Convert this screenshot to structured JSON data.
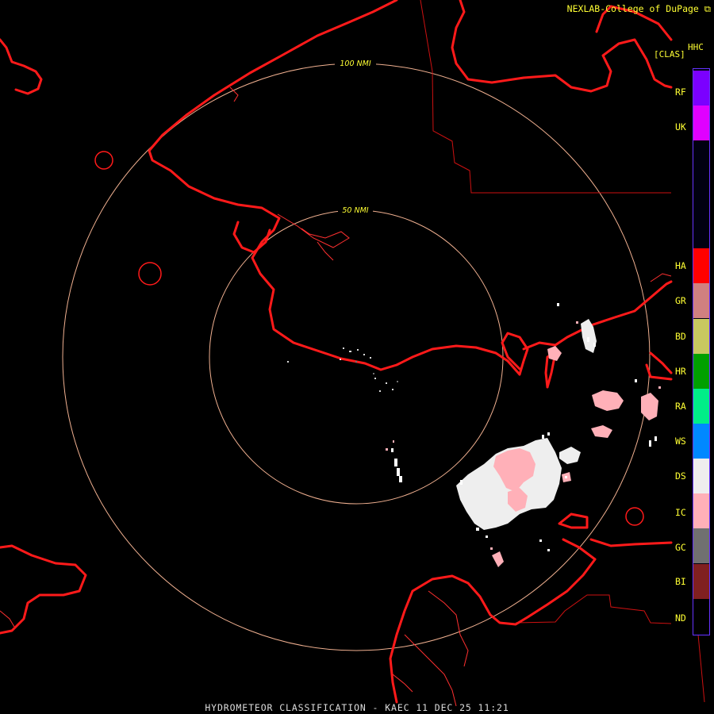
{
  "header": {
    "credit": "NEXLAB-College of DuPage",
    "credit_icon": "external-link-icon",
    "product_code": "HHC",
    "product_class": "[CLAS]"
  },
  "range_rings": [
    {
      "label": "100 NMI"
    },
    {
      "label": "50 NMI"
    }
  ],
  "legend": {
    "items": [
      {
        "code": "RF",
        "color": "#7b00ff"
      },
      {
        "code": "UK",
        "color": "#e000ff"
      },
      {
        "code": "HA",
        "color": "#ff0000"
      },
      {
        "code": "GR",
        "color": "#d08080"
      },
      {
        "code": "BD",
        "color": "#c8c860"
      },
      {
        "code": "HR",
        "color": "#00a000"
      },
      {
        "code": "RA",
        "color": "#00ee88"
      },
      {
        "code": "WS",
        "color": "#0088ff"
      },
      {
        "code": "DS",
        "color": "#eeeeee"
      },
      {
        "code": "IC",
        "color": "#ffb0b8"
      },
      {
        "code": "GC",
        "color": "#707070"
      },
      {
        "code": "BI",
        "color": "#802020"
      },
      {
        "code": "ND",
        "color": "#000000"
      }
    ]
  },
  "map_colors": {
    "coastline": "#ff1a1a",
    "county_lines": "#cc1111",
    "range_ring": "#f0b090",
    "ring_label": "#ffff33"
  },
  "footer": {
    "title": "HYDROMETEOR CLASSIFICATION - KAEC 11 DEC 25 11:21"
  }
}
